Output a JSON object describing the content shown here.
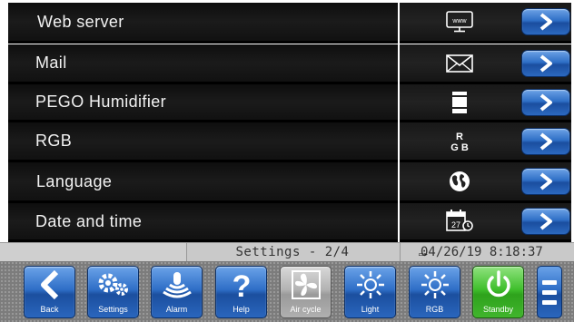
{
  "menu": {
    "items": [
      {
        "label": "Web server",
        "icon": "web-server-icon"
      },
      {
        "label": "Mail",
        "icon": "mail-icon"
      },
      {
        "label": "PEGO Humidifier",
        "icon": "humidifier-icon"
      },
      {
        "label": "RGB",
        "icon": "rgb-icon"
      },
      {
        "label": "Language",
        "icon": "globe-icon"
      },
      {
        "label": "Date and time",
        "icon": "calendar-clock-icon"
      }
    ],
    "web_icon_text": "www",
    "rgb_icon_text": {
      "r": "R",
      "gb": "G B"
    },
    "calendar_day": "27"
  },
  "status": {
    "title": "Settings - 2/4",
    "datetime": "04/26/19 8:18:37"
  },
  "toolbar": {
    "back": "Back",
    "settings": "Settings",
    "alarm": "Alarm",
    "help": "Help",
    "air_cycle": "Air cycle",
    "light": "Light",
    "rgb": "RGB",
    "standby": "Standby"
  },
  "colors": {
    "button_blue": "#2f6fc7",
    "standby_green": "#3fbf2c",
    "row_dark": "#141414"
  }
}
